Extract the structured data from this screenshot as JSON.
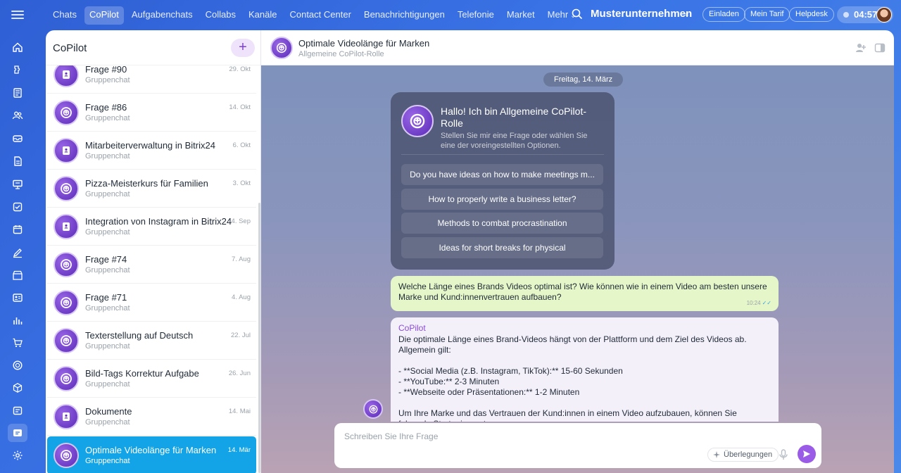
{
  "topnav": {
    "items": [
      {
        "label": "Chats",
        "active": false
      },
      {
        "label": "CoPilot",
        "active": true
      },
      {
        "label": "Aufgabenchats",
        "active": false
      },
      {
        "label": "Collabs",
        "active": false
      },
      {
        "label": "Kanäle",
        "active": false
      },
      {
        "label": "Contact Center",
        "active": false
      },
      {
        "label": "Benachrichtigungen",
        "active": false
      },
      {
        "label": "Telefonie",
        "active": false
      },
      {
        "label": "Market",
        "active": false
      }
    ],
    "more_label": "Mehr",
    "company": "Musterunternehmen",
    "invite_label": "Einladen",
    "tariff_label": "Mein Tarif",
    "helpdesk_label": "Helpdesk",
    "clock": "04:57"
  },
  "sidebar_rail": {
    "icons": [
      "home-icon",
      "puzzle-icon",
      "news-icon",
      "users-icon",
      "inbox-icon",
      "document-icon",
      "presentation-icon",
      "tasks-icon",
      "calendar-icon",
      "sign-icon",
      "store-icon",
      "contacts-icon",
      "analytics-icon",
      "shop-cart-icon",
      "copilot-rail-icon",
      "cube-icon",
      "planner-icon",
      "chat-active-icon",
      "settings-icon"
    ]
  },
  "chat_list": {
    "title": "CoPilot",
    "new_button": "+",
    "items": [
      {
        "title": "Frage #90",
        "subtitle": "Gruppenchat",
        "date": "29. Okt",
        "avatar": "document",
        "active": false
      },
      {
        "title": "Frage #86",
        "subtitle": "Gruppenchat",
        "date": "14. Okt",
        "avatar": "copilot",
        "active": false
      },
      {
        "title": "Mitarbeiterverwaltung in Bitrix24",
        "subtitle": "Gruppenchat",
        "date": "6. Okt",
        "avatar": "document",
        "active": false
      },
      {
        "title": "Pizza-Meisterkurs für Familien",
        "subtitle": "Gruppenchat",
        "date": "3. Okt",
        "avatar": "copilot",
        "active": false
      },
      {
        "title": "Integration von Instagram in Bitrix24",
        "subtitle": "Gruppenchat",
        "date": "4. Sep",
        "avatar": "document",
        "active": false
      },
      {
        "title": "Frage #74",
        "subtitle": "Gruppenchat",
        "date": "7. Aug",
        "avatar": "copilot",
        "active": false
      },
      {
        "title": "Frage #71",
        "subtitle": "Gruppenchat",
        "date": "4. Aug",
        "avatar": "copilot",
        "active": false
      },
      {
        "title": "Texterstellung auf Deutsch",
        "subtitle": "Gruppenchat",
        "date": "22. Jul",
        "avatar": "copilot",
        "active": false
      },
      {
        "title": "Bild-Tags Korrektur Aufgabe",
        "subtitle": "Gruppenchat",
        "date": "26. Jun",
        "avatar": "copilot",
        "active": false
      },
      {
        "title": "Dokumente",
        "subtitle": "Gruppenchat",
        "date": "14. Mai",
        "avatar": "document",
        "active": false
      },
      {
        "title": "Optimale Videolänge für Marken",
        "subtitle": "Gruppenchat",
        "date": "14. Mär",
        "avatar": "copilot",
        "active": true
      }
    ]
  },
  "chat": {
    "title": "Optimale Videolänge für Marken",
    "subtitle": "Allgemeine CoPilot-Rolle",
    "date_chip": "Freitag, 14. März",
    "welcome": {
      "title": "Hallo! Ich bin Allgemeine CoPilot-Rolle",
      "subtitle": "Stellen Sie mir eine Frage oder wählen Sie eine der voreingestellten Optionen.",
      "options": [
        "Do you have ideas on how to make meetings m...",
        "How to properly write a business letter?",
        "Methods to combat procrastination",
        "Ideas for short breaks for physical"
      ]
    },
    "user_message": {
      "text": "Welche Länge eines Brands Videos optimal ist? Wie können wie in einem Video am besten unsere Marke und Kund:innenvertrauen aufbauen?",
      "time": "10:24"
    },
    "bot_message": {
      "author": "CoPilot",
      "lines": [
        "Die optimale Länge eines Brand-Videos hängt von der Plattform und dem Ziel des Videos ab. Allgemein gilt:",
        "",
        "- **Social Media (z.B. Instagram, TikTok):** 15-60 Sekunden",
        "- **YouTube:** 2-3 Minuten",
        "- **Webseite oder Präsentationen:** 1-2 Minuten",
        "",
        "Um Ihre Marke und das Vertrauen der Kund:innen in einem Video aufzubauen, können Sie",
        "folgende Strategien nutzen:"
      ]
    },
    "input": {
      "placeholder": "Schreiben Sie Ihre Frage",
      "reasoning_label": "Überlegungen"
    }
  }
}
